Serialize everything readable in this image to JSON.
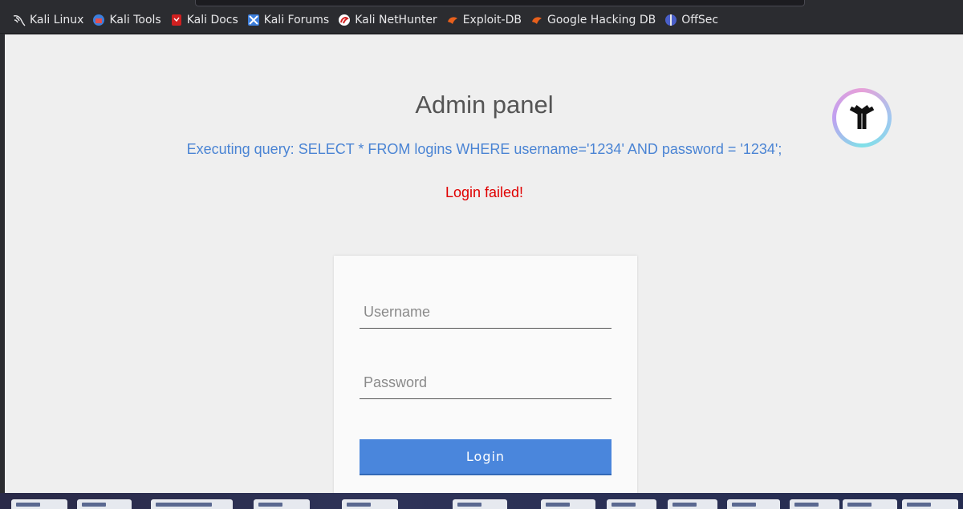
{
  "bookmarks": [
    {
      "label": "Kali Linux",
      "icon": "kali-dragon-icon"
    },
    {
      "label": "Kali Tools",
      "icon": "kali-tools-icon"
    },
    {
      "label": "Kali Docs",
      "icon": "kali-docs-icon"
    },
    {
      "label": "Kali Forums",
      "icon": "kali-forums-icon"
    },
    {
      "label": "Kali NetHunter",
      "icon": "nethunter-icon"
    },
    {
      "label": "Exploit-DB",
      "icon": "exploit-db-icon"
    },
    {
      "label": "Google Hacking DB",
      "icon": "ghdb-icon"
    },
    {
      "label": "OffSec",
      "icon": "offsec-icon"
    }
  ],
  "page": {
    "title": "Admin panel",
    "query": "Executing query: SELECT * FROM logins WHERE username='1234' AND password = '1234';",
    "error": "Login failed!",
    "error_color": "#e00000",
    "query_color": "#4a84d4"
  },
  "form": {
    "username_placeholder": "Username",
    "password_placeholder": "Password",
    "login_label": "Login",
    "button_color": "#4a86dc"
  }
}
